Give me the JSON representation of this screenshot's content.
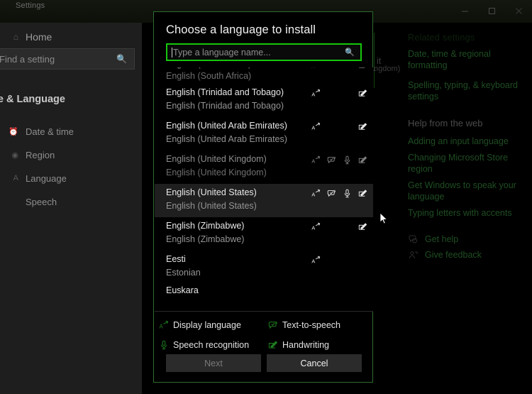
{
  "window": {
    "title": "Settings",
    "controls": [
      {
        "name": "minimize",
        "glyph": "minimize-icon"
      },
      {
        "name": "maximize",
        "glyph": "maximize-icon"
      },
      {
        "name": "close",
        "glyph": "close-icon"
      }
    ]
  },
  "sidebar": {
    "home_label": "Home",
    "home_icon": "home-icon",
    "search": {
      "placeholder": "Find a setting",
      "icon": "search-icon"
    },
    "heading": "me & Language",
    "items": [
      {
        "label": "Date & time",
        "icon": "clock-icon"
      },
      {
        "label": "Region",
        "icon": "globe-icon"
      },
      {
        "label": "Language",
        "icon": "language-icon"
      },
      {
        "label": "Speech",
        "icon": "speech-icon"
      }
    ]
  },
  "right_panel": {
    "related_heading": "Related settings",
    "related_links": [
      "Date, time & regional formatting",
      "Spelling, typing, & keyboard settings"
    ],
    "help_heading": "Help from the web",
    "help_links": [
      "Adding an input language",
      "Changing Microsoft Store region",
      "Get Windows to speak your language",
      "Typing letters with accents"
    ],
    "footer_links": [
      {
        "label": "Get help",
        "icon": "help-chat-icon"
      },
      {
        "label": "Give feedback",
        "icon": "feedback-icon"
      }
    ]
  },
  "background_fragments": {
    "frag_top": "it",
    "frag_sub": "ngdom)"
  },
  "dialog": {
    "title": "Choose a language to install",
    "search": {
      "placeholder": "Type a language name...",
      "value": "",
      "icon": "search-icon"
    },
    "languages": [
      {
        "native": "English (South Africa)",
        "english": "English (South Africa)",
        "icons": [
          "display-language-icon",
          "handwriting-icon"
        ],
        "selected": false,
        "dim": true,
        "clip": "top"
      },
      {
        "native": "English (Trinidad and Tobago)",
        "english": "English (Trinidad and Tobago)",
        "icons": [
          "display-language-icon",
          "handwriting-icon"
        ],
        "selected": false,
        "dim": false,
        "clip": "none"
      },
      {
        "native": "English (United Arab Emirates)",
        "english": "English (United Arab Emirates)",
        "icons": [
          "display-language-icon",
          "handwriting-icon"
        ],
        "selected": false,
        "dim": false,
        "clip": "none"
      },
      {
        "native": "English (United Kingdom)",
        "english": "English (United Kingdom)",
        "icons": [
          "display-language-icon",
          "text-to-speech-icon",
          "speech-recognition-icon",
          "handwriting-icon"
        ],
        "selected": false,
        "dim": true,
        "clip": "none"
      },
      {
        "native": "English (United States)",
        "english": "English (United States)",
        "icons": [
          "display-language-icon",
          "text-to-speech-icon",
          "speech-recognition-icon",
          "handwriting-icon"
        ],
        "selected": true,
        "dim": false,
        "clip": "none"
      },
      {
        "native": "English (Zimbabwe)",
        "english": "English (Zimbabwe)",
        "icons": [
          "display-language-icon",
          "handwriting-icon"
        ],
        "selected": false,
        "dim": false,
        "clip": "none"
      },
      {
        "native": "Eesti",
        "english": "Estonian",
        "icons": [
          "display-language-icon"
        ],
        "selected": false,
        "dim": false,
        "clip": "none"
      },
      {
        "native": "Euskara",
        "english": "",
        "icons": [],
        "selected": false,
        "dim": false,
        "clip": "bottom"
      }
    ],
    "legend": [
      {
        "label": "Display language",
        "icon": "display-language-icon"
      },
      {
        "label": "Text-to-speech",
        "icon": "text-to-speech-icon"
      },
      {
        "label": "Speech recognition",
        "icon": "speech-recognition-icon"
      },
      {
        "label": "Handwriting",
        "icon": "handwriting-icon"
      }
    ],
    "buttons": {
      "next": {
        "label": "Next",
        "disabled": true
      },
      "cancel": {
        "label": "Cancel",
        "disabled": false
      }
    }
  },
  "colors": {
    "accent_green": "#16c60c",
    "dialog_border": "#2f6b2f",
    "legend_icon": "#1f7a1f",
    "selected_row": "#1f1f1f",
    "dialog_bg": "#000000",
    "sidebar_bg": "#1e1e1e",
    "link_green": "#1f4d22"
  }
}
